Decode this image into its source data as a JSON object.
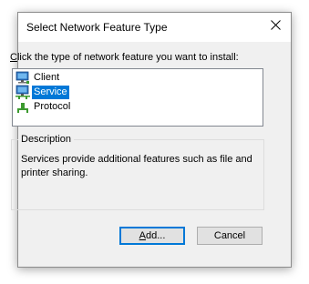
{
  "window": {
    "title": "Select Network Feature Type",
    "close_icon": "close-icon"
  },
  "instruction": {
    "accesskey": "C",
    "rest": "lick the type of network feature you want to install:"
  },
  "feature_list": {
    "items": [
      {
        "label": "Client",
        "icon": "client-computer-icon",
        "selected": false
      },
      {
        "label": "Service",
        "icon": "service-network-icon",
        "selected": true
      },
      {
        "label": "Protocol",
        "icon": "protocol-icon",
        "selected": false
      }
    ]
  },
  "description": {
    "legend": "Description",
    "text": "Services provide additional features such as file and printer sharing."
  },
  "buttons": {
    "add_accesskey": "A",
    "add_rest": "dd...",
    "cancel": "Cancel"
  },
  "colors": {
    "selection": "#0078d7",
    "dialog_bg": "#f0f0f0",
    "button_bg": "#e1e1e1"
  }
}
